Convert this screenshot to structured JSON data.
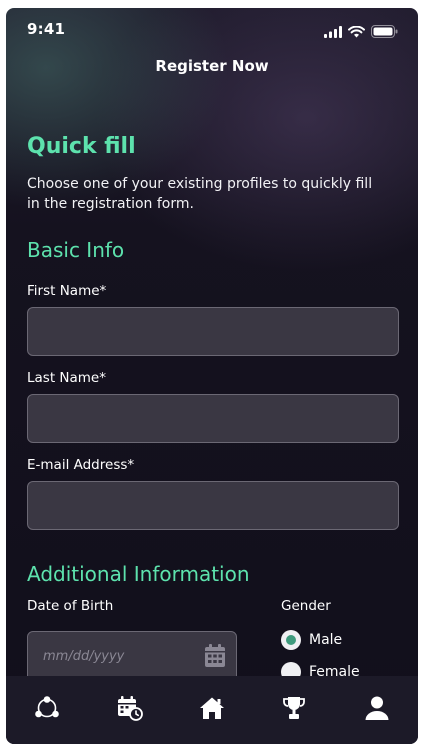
{
  "status_bar": {
    "time": "9:41"
  },
  "header": {
    "title": "Register Now"
  },
  "quick_fill": {
    "title": "Quick fill",
    "description": "Choose one of your existing profiles to quickly fill in the registration form."
  },
  "basic_info": {
    "title": "Basic Info",
    "first_name_label": "First Name*",
    "first_name_value": "",
    "last_name_label": "Last Name*",
    "last_name_value": "",
    "email_label": "E-mail Address*",
    "email_value": ""
  },
  "additional_info": {
    "title": "Additional Information",
    "dob_label": "Date of Birth",
    "dob_placeholder": "mm/dd/yyyy",
    "gender_label": "Gender",
    "gender_options": [
      "Male",
      "Female"
    ],
    "gender_selected": "Male"
  },
  "bottom_nav": {
    "items": [
      {
        "icon": "network-icon"
      },
      {
        "icon": "calendar-clock-icon"
      },
      {
        "icon": "home-icon"
      },
      {
        "icon": "trophy-icon"
      },
      {
        "icon": "profile-icon"
      }
    ]
  },
  "colors": {
    "accent": "#5de2ad",
    "radio_selected": "#3f9b7d",
    "input_bg": "#3a3743",
    "nav_bg": "#1c1a28"
  }
}
